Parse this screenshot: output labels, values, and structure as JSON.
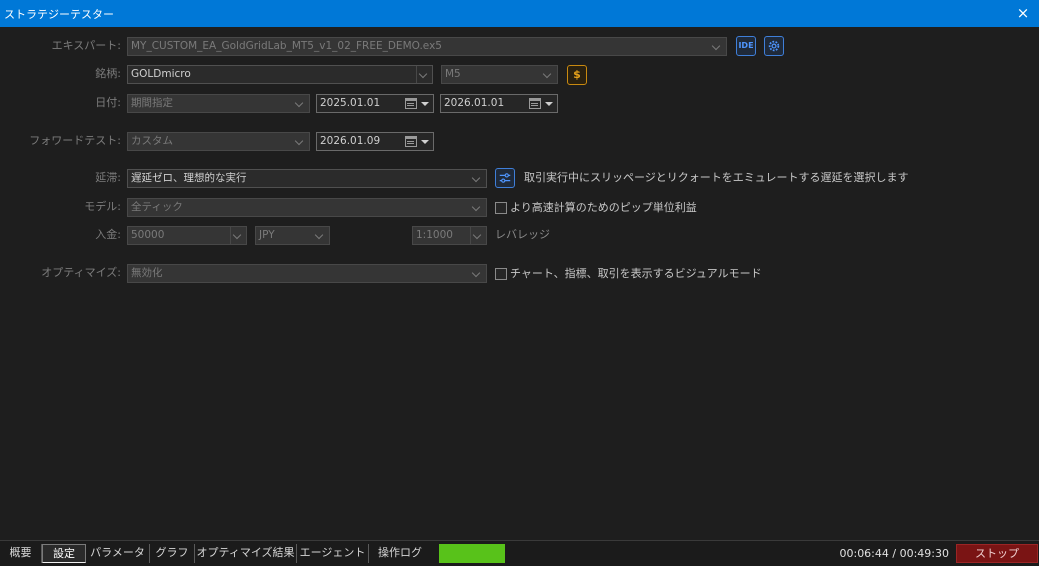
{
  "window": {
    "title": "ストラテジーテスター",
    "close_icon": "×"
  },
  "form": {
    "expert": {
      "label": "エキスパート:",
      "value": "MY_CUSTOM_EA_GoldGridLab_MT5_v1_02_FREE_DEMO.ex5",
      "ide_label": "IDE"
    },
    "symbol": {
      "label": "銘柄:",
      "value": "GOLDmicro",
      "timeframe": "M5",
      "symbol_button": "$"
    },
    "date": {
      "label": "日付:",
      "mode": "期間指定",
      "from": "2025.01.01",
      "to": "2026.01.01"
    },
    "forward": {
      "label": "フォワードテスト:",
      "mode": "カスタム",
      "date": "2026.01.09"
    },
    "delay": {
      "label": "延滞:",
      "value": "遅延ゼロ、理想的な実行",
      "hint": "取引実行中にスリッページとリクォートをエミュレートする遅延を選択します"
    },
    "model": {
      "label": "モデル:",
      "value": "全ティック",
      "checkbox_label": "より高速計算のためのピップ単位利益",
      "checked": false
    },
    "deposit": {
      "label": "入金:",
      "value": "50000",
      "currency": "JPY",
      "leverage": "1:1000",
      "leverage_label": "レバレッジ"
    },
    "optimize": {
      "label": "オプティマイズ:",
      "value": "無効化",
      "checkbox_label": "チャート、指標、取引を表示するビジュアルモード",
      "checked": false
    }
  },
  "tabs": [
    {
      "label": "概要"
    },
    {
      "label": "設定"
    },
    {
      "label": "パラメータ"
    },
    {
      "label": "グラフ"
    },
    {
      "label": "オプティマイズ結果"
    },
    {
      "label": "エージェント"
    },
    {
      "label": "操作ログ"
    }
  ],
  "active_tab": "設定",
  "status": {
    "timer": "00:06:44 / 00:49:30",
    "stop_label": "ストップ",
    "progress_color": "#58c21a",
    "accent": "#0078d7"
  }
}
